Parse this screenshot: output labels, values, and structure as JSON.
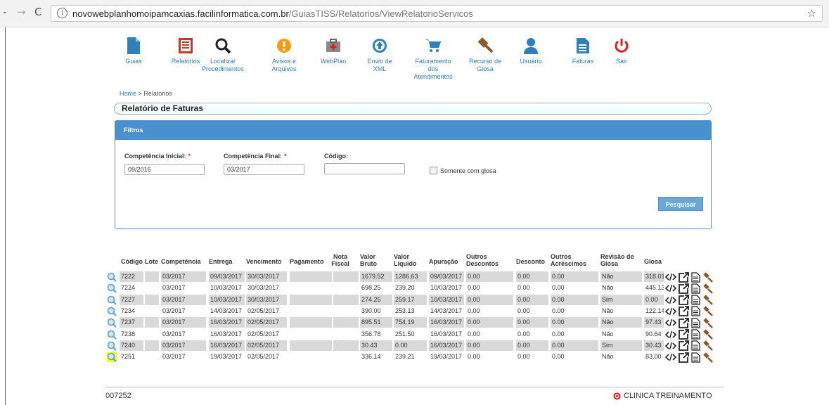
{
  "browser": {
    "url_host": "novowebplanhomoipamcaxias.facilinformatica.com.br",
    "url_path": "/GuiasTISS/Relatorios/ViewRelatorioServicos"
  },
  "menu": [
    {
      "label": "Guias",
      "icon": "document-icon"
    },
    {
      "label": "Relatorios",
      "icon": "report-icon"
    },
    {
      "label": "Localizar Procedimentos",
      "icon": "search-icon"
    },
    {
      "label": "Avisos e Arquivos",
      "icon": "warning-icon"
    },
    {
      "label": "WebPlan",
      "icon": "medkit-icon"
    },
    {
      "label": "Envio de XML",
      "icon": "upload-icon"
    },
    {
      "label": "Faturamento dos Atendimentos",
      "icon": "cart-icon"
    },
    {
      "label": "Recurso de Glosa",
      "icon": "gavel-icon"
    },
    {
      "label": "Usuário",
      "icon": "user-icon"
    },
    {
      "label": "Faturas",
      "icon": "invoice-icon"
    },
    {
      "label": "Sair",
      "icon": "power-icon"
    }
  ],
  "breadcrumb": {
    "home": "Home",
    "sep": ">",
    "current": "Relatorios"
  },
  "page_title": "Relatório de Faturas",
  "filters": {
    "header": "Filtros",
    "competencia_inicial_label": "Competência Inicial:",
    "competencia_inicial_value": "09/2016",
    "competencia_final_label": "Competência Final:",
    "competencia_final_value": "03/2017",
    "codigo_label": "Código:",
    "codigo_value": "",
    "somente_glosa_label": "Somente com glosa",
    "required_mark": "*",
    "search_button": "Pesquisar"
  },
  "table": {
    "headers": [
      "Código",
      "Lote",
      "Competência",
      "Entrega",
      "Vencimento",
      "Pagamento",
      "Nota Fiscal",
      "Valor Bruto",
      "Valor Líquido",
      "Apuração",
      "Outros Descontos",
      "Desconto",
      "Outros Acréscimos",
      "Revisão de Glosa",
      "Glosa"
    ],
    "rows": [
      {
        "codigo": "7222",
        "lote": "",
        "competencia": "03/2017",
        "entrega": "09/03/2017",
        "vencimento": "30/03/2017",
        "pagamento": "",
        "nota": "",
        "bruto": "1679.52",
        "liquido": "1286.63",
        "apuracao": "09/03/2017",
        "outros_desc": "0.00",
        "desconto": "0.00",
        "outros_acr": "0.00",
        "revisao": "Não",
        "glosa": "318.01"
      },
      {
        "codigo": "7224",
        "lote": "",
        "competencia": "03/2017",
        "entrega": "10/03/2017",
        "vencimento": "30/03/2017",
        "pagamento": "",
        "nota": "",
        "bruto": "698.25",
        "liquido": "239.20",
        "apuracao": "10/03/2017",
        "outros_desc": "0.00",
        "desconto": "0.00",
        "outros_acr": "0.00",
        "revisao": "Não",
        "glosa": "445.13"
      },
      {
        "codigo": "7227",
        "lote": "",
        "competencia": "03/2017",
        "entrega": "10/03/2017",
        "vencimento": "30/03/2017",
        "pagamento": "",
        "nota": "",
        "bruto": "274.25",
        "liquido": "259.17",
        "apuracao": "10/03/2017",
        "outros_desc": "0.00",
        "desconto": "0.00",
        "outros_acr": "0.00",
        "revisao": "Sim",
        "glosa": "0.00"
      },
      {
        "codigo": "7234",
        "lote": "",
        "competencia": "03/2017",
        "entrega": "14/03/2017",
        "vencimento": "02/05/2017",
        "pagamento": "",
        "nota": "",
        "bruto": "390.00",
        "liquido": "253.13",
        "apuracao": "14/03/2017",
        "outros_desc": "0.00",
        "desconto": "0.00",
        "outros_acr": "0.00",
        "revisao": "Não",
        "glosa": "122.14"
      },
      {
        "codigo": "7237",
        "lote": "",
        "competencia": "03/2017",
        "entrega": "16/03/2017",
        "vencimento": "02/05/2017",
        "pagamento": "",
        "nota": "",
        "bruto": "895.51",
        "liquido": "754.19",
        "apuracao": "16/03/2017",
        "outros_desc": "0.00",
        "desconto": "0.00",
        "outros_acr": "0.00",
        "revisao": "Não",
        "glosa": "97.43"
      },
      {
        "codigo": "7238",
        "lote": "",
        "competencia": "03/2017",
        "entrega": "16/03/2017",
        "vencimento": "02/05/2017",
        "pagamento": "",
        "nota": "",
        "bruto": "356.78",
        "liquido": "251.50",
        "apuracao": "16/03/2017",
        "outros_desc": "0.00",
        "desconto": "0.00",
        "outros_acr": "0.00",
        "revisao": "Não",
        "glosa": "90.64"
      },
      {
        "codigo": "7240",
        "lote": "",
        "competencia": "03/2017",
        "entrega": "16/03/2017",
        "vencimento": "02/05/2017",
        "pagamento": "",
        "nota": "",
        "bruto": "30.43",
        "liquido": "0.00",
        "apuracao": "16/03/2017",
        "outros_desc": "0.00",
        "desconto": "0.00",
        "outros_acr": "0.00",
        "revisao": "Sim",
        "glosa": "30.43"
      },
      {
        "codigo": "7251",
        "lote": "",
        "competencia": "03/2017",
        "entrega": "19/03/2017",
        "vencimento": "02/05/2017",
        "pagamento": "",
        "nota": "",
        "bruto": "336.14",
        "liquido": "239.21",
        "apuracao": "19/03/2017",
        "outros_desc": "0.00",
        "desconto": "0.00",
        "outros_acr": "0.00",
        "revisao": "Não",
        "glosa": "83.00"
      }
    ]
  },
  "footer": {
    "left": "007252",
    "right": "CLINICA TREINAMENTO"
  },
  "colors": {
    "accent": "#4a8fce",
    "link": "#2f7fb8",
    "danger": "#e02020",
    "warning": "#f39c12",
    "gavel": "#8a5a2b",
    "highlight": "#ffff00"
  }
}
